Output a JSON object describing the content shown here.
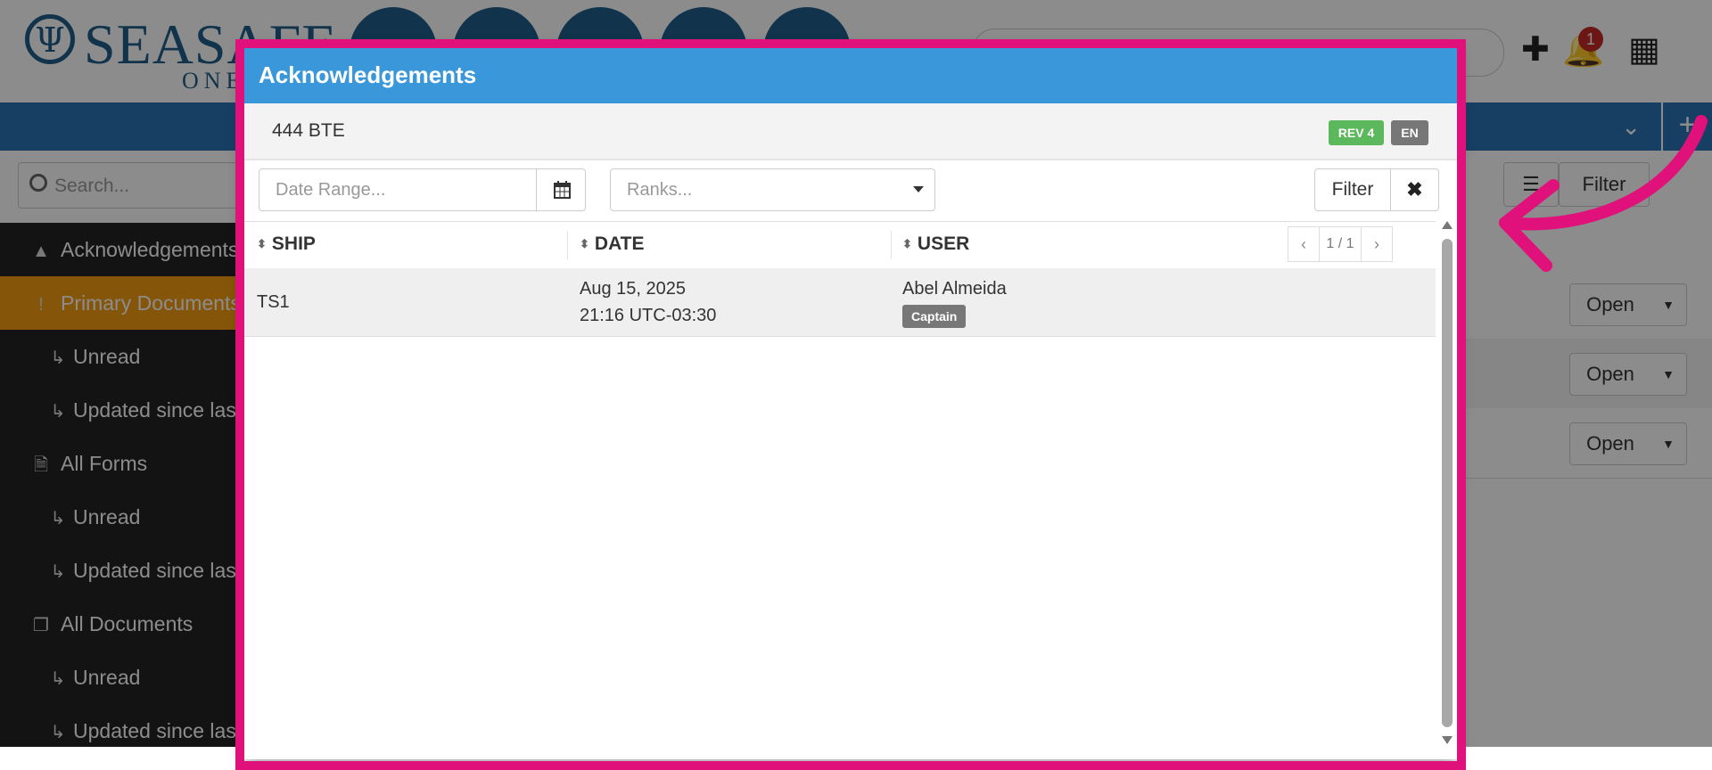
{
  "app": {
    "logo_text": "SEASAFE",
    "logo_sub": "ONE",
    "notification_count": "1",
    "search_placeholder": "Search...",
    "sidebar": {
      "items": [
        {
          "label": "Acknowledgements",
          "icon": "warning-icon"
        },
        {
          "label": "Primary Documents",
          "icon": "exclamation-icon"
        },
        {
          "label": "Unread",
          "icon": "sub-arrow-icon"
        },
        {
          "label": "Updated since last",
          "icon": "sub-arrow-icon"
        },
        {
          "label": "All Forms",
          "icon": "document-icon"
        },
        {
          "label": "Unread",
          "icon": "sub-arrow-icon"
        },
        {
          "label": "Updated since last",
          "icon": "sub-arrow-icon"
        },
        {
          "label": "All Documents",
          "icon": "documents-icon"
        },
        {
          "label": "Unread",
          "icon": "sub-arrow-icon"
        },
        {
          "label": "Updated since last",
          "icon": "sub-arrow-icon"
        }
      ]
    },
    "right_panel": {
      "filter_label": "Filter",
      "pager_text": "1 / 1",
      "open_label": "Open"
    }
  },
  "modal": {
    "title": "Acknowledgements",
    "document": {
      "name": "444 BTE",
      "revision": "REV 4",
      "language": "EN"
    },
    "filters": {
      "date_range_placeholder": "Date Range...",
      "ranks_placeholder": "Ranks...",
      "filter_label": "Filter",
      "clear_label": "✖"
    },
    "table": {
      "columns": [
        "SHIP",
        "DATE",
        "USER"
      ],
      "pager": {
        "text": "1 / 1",
        "prev": "‹",
        "next": "›"
      },
      "rows": [
        {
          "ship": "TS1",
          "date": "Aug 15, 2025",
          "time": "21:16 UTC-03:30",
          "user": "Abel Almeida",
          "rank": "Captain"
        }
      ]
    }
  },
  "colors": {
    "modal_header": "#3a97d9",
    "revision_badge": "#5cb85c",
    "language_badge": "#777777",
    "annotation": "#e0117a",
    "sidebar_active": "#f39c12"
  }
}
